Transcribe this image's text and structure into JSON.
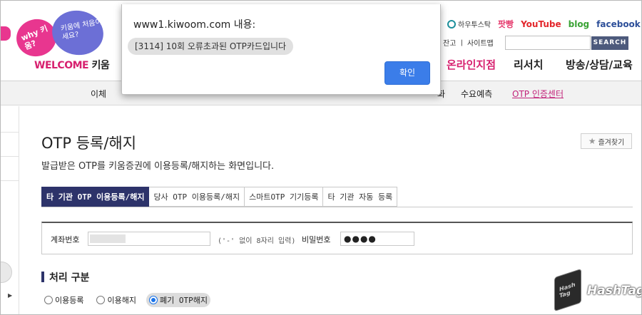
{
  "header": {
    "logo_left": "why 키움?",
    "logo_right": "키움에 처음이세요?",
    "welcome": "WELCOME",
    "welcome_brand": "키움",
    "top_links": {
      "hts": "하우투스탁",
      "podcast": "팟빵",
      "youtube": "YouTube",
      "blog": "blog",
      "facebook": "facebook"
    },
    "sub_links": "잔고 ㅣ 사이트맵",
    "search_label": "SEARCH",
    "gnb": [
      "온라인지점",
      "리서치",
      "방송/상담/교육"
    ],
    "gnb_active_index": 0
  },
  "subnav": {
    "items": [
      "이체",
      "화",
      "수요예측",
      "OTP 인증센터"
    ],
    "active": "OTP 인증센터"
  },
  "page": {
    "title": "OTP 등록/해지",
    "description": "발급받은 OTP를 키움증권에 이용등록/해지하는 화면입니다.",
    "favorite_label": "즐겨찾기",
    "tabs": [
      {
        "label": "타 기관 OTP 이용등록/해지",
        "active": true
      },
      {
        "label": "당사 OTP 이용등록/해지",
        "active": false
      },
      {
        "label": "스마트OTP 기기등록",
        "active": false
      },
      {
        "label": "타 기관 자동 등록",
        "active": false
      }
    ],
    "form": {
      "account_label": "계좌번호",
      "account_hint": "('-' 없이 8자리 입력)",
      "password_label": "비밀번호",
      "password_value": "●●●●"
    },
    "section_title": "처리 구분",
    "radios": [
      {
        "label": "이용등록",
        "selected": false
      },
      {
        "label": "이용해지",
        "selected": false
      },
      {
        "label": "폐기 OTP해지",
        "selected": true
      }
    ]
  },
  "dialog": {
    "title": "www1.kiwoom.com 내용:",
    "message": "[3114] 10회 오류초과된 OTP카드입니다",
    "ok_label": "확인"
  },
  "watermark": {
    "icon_text": "Hash Tag",
    "text": "HashTag"
  },
  "colors": {
    "brand_pink": "#d7206f",
    "tab_active_bg": "#2d336a",
    "dialog_button": "#3b7de9"
  }
}
